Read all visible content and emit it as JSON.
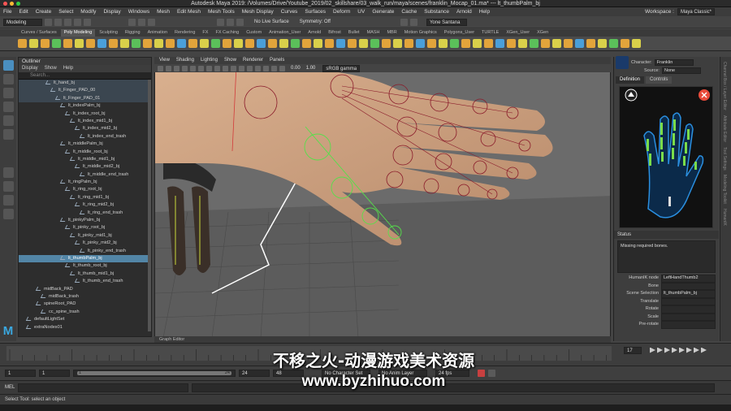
{
  "window": {
    "title": "Autodesk Maya 2019: /Volumes/Drive/Youtube_2019/02_skillshare/03_walk_run/maya/scenes/franklin_Mocap_01.ma*   ---   lt_thumbPalm_bj"
  },
  "menubar": {
    "items": [
      "File",
      "Edit",
      "Create",
      "Select",
      "Modify",
      "Display",
      "Windows",
      "Mesh",
      "Edit Mesh",
      "Mesh Tools",
      "Mesh Display",
      "Curves",
      "Surfaces",
      "Deform",
      "UV",
      "Generate",
      "Cache",
      "Substance",
      "Arnold",
      "Help"
    ],
    "workspace_label": "Workspace :",
    "workspace_value": "Maya Classic*"
  },
  "statusline": {
    "mode": "Modeling",
    "live_surface": "No Live Surface",
    "symmetry": "Symmetry: Off",
    "user": "Yone Santana"
  },
  "shelf": {
    "tabs": [
      "Curves / Surfaces",
      "Poly Modeling",
      "Sculpting",
      "Rigging",
      "Animation",
      "Rendering",
      "FX",
      "FX Caching",
      "Custom",
      "Animation_User",
      "Arnold",
      "Bifrost",
      "Bullet",
      "MASH",
      "MBR",
      "Motion Graphics",
      "Polygons_User",
      "TURTLE",
      "XGen_User",
      "XGen"
    ],
    "active_tab": "Poly Modeling",
    "icon_colors": [
      "#e2a43b",
      "#d9d04a",
      "#e2a43b",
      "#5bc05a",
      "#e2a43b",
      "#d9d04a",
      "#e2a43b",
      "#4a9fd9",
      "#e2a43b",
      "#d9d04a",
      "#5bc05a",
      "#e2a43b",
      "#d9d04a",
      "#e2a43b",
      "#4a9fd9",
      "#e2a43b",
      "#d9d04a",
      "#5bc05a",
      "#e2a43b",
      "#d9d04a",
      "#e2a43b",
      "#4a9fd9",
      "#e2a43b",
      "#d9d04a",
      "#5bc05a",
      "#e2a43b",
      "#d9d04a",
      "#e2a43b",
      "#4a9fd9",
      "#e2a43b",
      "#d9d04a",
      "#5bc05a",
      "#e2a43b",
      "#d9d04a",
      "#e2a43b",
      "#4a9fd9",
      "#e2a43b",
      "#d9d04a",
      "#5bc05a",
      "#e2a43b",
      "#d9d04a",
      "#e2a43b",
      "#4a9fd9",
      "#e2a43b",
      "#d9d04a",
      "#5bc05a",
      "#e2a43b",
      "#d9d04a",
      "#e2a43b",
      "#4a9fd9",
      "#e2a43b",
      "#d9d04a",
      "#5bc05a",
      "#e2a43b",
      "#d9d04a"
    ]
  },
  "outliner": {
    "title": "Outliner",
    "menus": [
      "Display",
      "Show",
      "Help"
    ],
    "search_placeholder": "Search...",
    "rows": [
      {
        "label": "lt_hand_bj",
        "indent": 5,
        "state": "dark"
      },
      {
        "label": "lt_Finger_PAD_00",
        "indent": 6,
        "state": "dark"
      },
      {
        "label": "lt_Finger_PAD_01",
        "indent": 7,
        "state": "dark"
      },
      {
        "label": "lt_indexPalm_bj",
        "indent": 8,
        "state": ""
      },
      {
        "label": "lt_index_root_bj",
        "indent": 9,
        "state": ""
      },
      {
        "label": "lt_index_mid1_bj",
        "indent": 10,
        "state": ""
      },
      {
        "label": "lt_index_mid2_bj",
        "indent": 11,
        "state": ""
      },
      {
        "label": "lt_index_end_trash",
        "indent": 12,
        "state": ""
      },
      {
        "label": "lt_middlePalm_bj",
        "indent": 8,
        "state": ""
      },
      {
        "label": "lt_middle_root_bj",
        "indent": 9,
        "state": ""
      },
      {
        "label": "lt_middle_mid1_bj",
        "indent": 10,
        "state": ""
      },
      {
        "label": "lt_middle_mid2_bj",
        "indent": 11,
        "state": ""
      },
      {
        "label": "lt_middle_end_trash",
        "indent": 12,
        "state": ""
      },
      {
        "label": "lt_ringPalm_bj",
        "indent": 8,
        "state": ""
      },
      {
        "label": "lt_ring_root_bj",
        "indent": 9,
        "state": ""
      },
      {
        "label": "lt_ring_mid1_bj",
        "indent": 10,
        "state": ""
      },
      {
        "label": "lt_ring_mid2_bj",
        "indent": 11,
        "state": ""
      },
      {
        "label": "lt_ring_end_trash",
        "indent": 12,
        "state": ""
      },
      {
        "label": "lt_pinkyPalm_bj",
        "indent": 8,
        "state": ""
      },
      {
        "label": "lt_pinky_root_bj",
        "indent": 9,
        "state": ""
      },
      {
        "label": "lt_pinky_mid1_bj",
        "indent": 10,
        "state": ""
      },
      {
        "label": "lt_pinky_mid2_bj",
        "indent": 11,
        "state": ""
      },
      {
        "label": "lt_pinky_end_trash",
        "indent": 12,
        "state": ""
      },
      {
        "label": "lt_thumbPalm_bj",
        "indent": 8,
        "state": "sel"
      },
      {
        "label": "lt_thumb_root_bj",
        "indent": 9,
        "state": ""
      },
      {
        "label": "lt_thumb_mid1_bj",
        "indent": 10,
        "state": ""
      },
      {
        "label": "lt_thumb_end_trash",
        "indent": 11,
        "state": ""
      },
      {
        "label": "midBack_PAD",
        "indent": 3,
        "state": ""
      },
      {
        "label": "midBack_trash",
        "indent": 4,
        "state": ""
      },
      {
        "label": "spineRoot_PAD",
        "indent": 3,
        "state": ""
      },
      {
        "label": "cc_spine_trash",
        "indent": 4,
        "state": ""
      },
      {
        "label": "defaultLightSet",
        "indent": 1,
        "state": ""
      },
      {
        "label": "extraNodes01",
        "indent": 1,
        "state": ""
      }
    ]
  },
  "viewport": {
    "menus": [
      "View",
      "Shading",
      "Lighting",
      "Show",
      "Renderer",
      "Panels"
    ],
    "field_a": "0.00",
    "field_b": "1.00",
    "colorspace": "sRGB gamma",
    "graph_label": "Graph Editor"
  },
  "hik": {
    "character_label": "Character:",
    "character_value": "Franklin",
    "source_label": "Source:",
    "source_value": "None",
    "tabs": [
      "Definition",
      "Controls"
    ],
    "active_tab": "Definition",
    "status_label": "Status",
    "status_message": "Missing required bones.",
    "fields": [
      {
        "label": "HumanIK node",
        "value": "LeftHandThumb2"
      },
      {
        "label": "Bone",
        "value": ""
      },
      {
        "label": "Scene Selection",
        "value": "lt_thumbPalm_bj"
      },
      {
        "label": "Translate",
        "value": ""
      },
      {
        "label": "Rotate",
        "value": ""
      },
      {
        "label": "Scale",
        "value": ""
      },
      {
        "label": "Pre-rotate",
        "value": ""
      }
    ]
  },
  "sidetabs": [
    "Channel Box / Layer Editor",
    "Attribute Editor",
    "Tool Settings",
    "Modeling Toolkit",
    "HumanIK"
  ],
  "timeline": {
    "current_frame": "17"
  },
  "range": {
    "start": "1",
    "inner_start": "1",
    "slider_start": "1",
    "slider_end": "24",
    "inner_end": "24",
    "end": "48",
    "character_set": "No Character Set",
    "anim_layer": "No Anim Layer",
    "fps": "24 fps"
  },
  "mel": {
    "label": "MEL"
  },
  "helpline": {
    "text": "Select Tool: select an object"
  },
  "watermark": {
    "line1": "不移之火-动漫游戏美术资源",
    "line2": "www.byzhihuo.com"
  },
  "logo": {
    "text": "M"
  }
}
